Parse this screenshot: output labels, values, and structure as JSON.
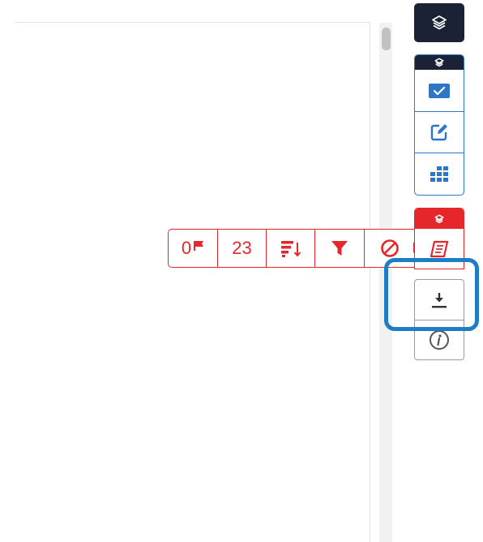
{
  "red_toolbar": {
    "flags_count": "0",
    "items_count": "23"
  },
  "icons": {
    "layers": "layers-icon",
    "check": "checkbox-icon",
    "edit": "edit-icon",
    "grid": "grid-icon",
    "flag": "flag-icon",
    "sort": "sort-icon",
    "filter": "filter-icon",
    "clear": "no-entry-icon",
    "list": "notes-icon",
    "download": "download-icon",
    "info": "info-icon"
  },
  "colors": {
    "dark": "#1c2236",
    "blue": "#2d77c6",
    "red": "#e5272b",
    "gray": "#9a9a9a",
    "highlight": "#1d7ec6"
  }
}
